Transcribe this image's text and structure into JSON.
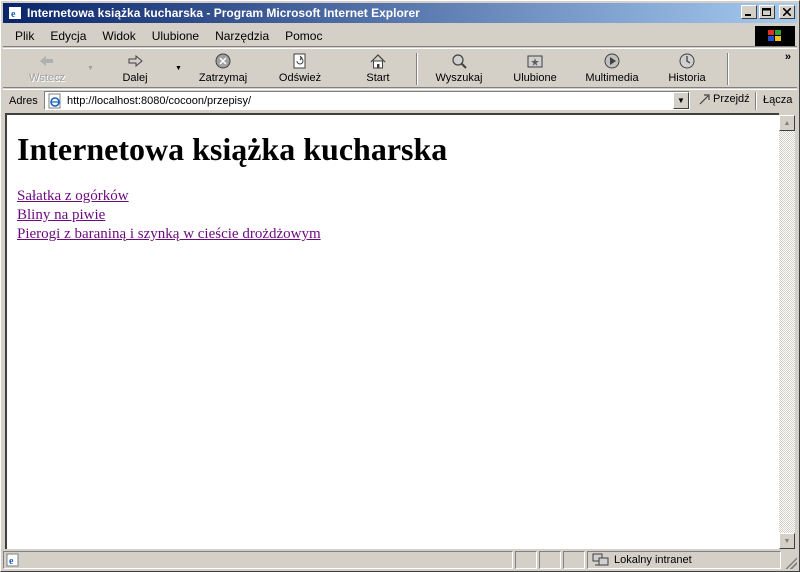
{
  "window": {
    "title": "Internetowa książka kucharska - Program Microsoft Internet Explorer",
    "title_icon": "ie-icon",
    "controls": {
      "minimize": "_",
      "maximize": "□",
      "close": "✕"
    }
  },
  "menubar": {
    "items": [
      "Plik",
      "Edycja",
      "Widok",
      "Ulubione",
      "Narzędzia",
      "Pomoc"
    ]
  },
  "toolbar": {
    "back": "Wstecz",
    "forward": "Dalej",
    "stop": "Zatrzymaj",
    "refresh": "Odśwież",
    "home": "Start",
    "search": "Wyszukaj",
    "favorites": "Ulubione",
    "media": "Multimedia",
    "history": "Historia",
    "chevron": "»"
  },
  "addressbar": {
    "label": "Adres",
    "url": "http://localhost:8080/cocoon/przepisy/",
    "go": "Przejdź",
    "links": "Łącza"
  },
  "page": {
    "heading": "Internetowa książka kucharska",
    "links": [
      "Sałatka z ogórków",
      "Bliny na piwie",
      "Pierogi z baraniną i szynką w cieście drożdżowym"
    ]
  },
  "statusbar": {
    "zone": "Lokalny intranet"
  },
  "colors": {
    "titlebar_start": "#0a246a",
    "titlebar_end": "#a6caf0",
    "visited_link": "#6b0a7e",
    "chrome": "#d4d0c8"
  }
}
